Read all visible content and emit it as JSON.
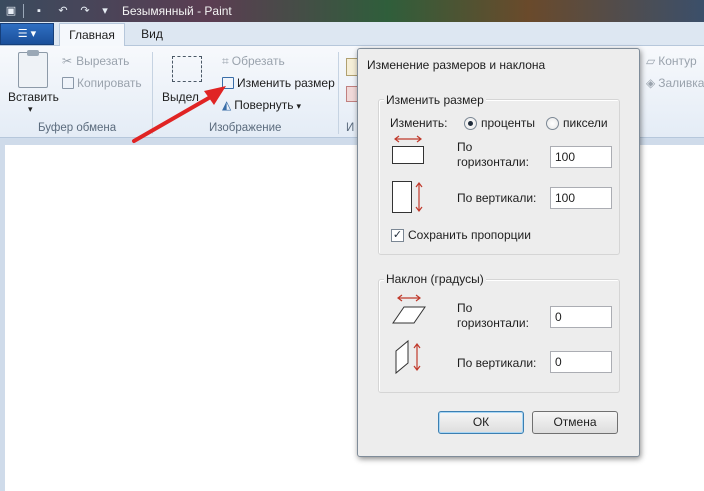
{
  "app": {
    "window_title": "Безымянный - Paint"
  },
  "tabs": {
    "file_icon": "menu-icon",
    "home": "Главная",
    "view": "Вид"
  },
  "ribbon": {
    "clipboard": {
      "paste": "Вставить",
      "cut": "Вырезать",
      "copy": "Копировать",
      "label": "Буфер обмена"
    },
    "image": {
      "select": "Выдел",
      "crop": "Обрезать",
      "resize": "Изменить размер",
      "rotate": "Повернуть",
      "label": "Изображение"
    },
    "tools_label": "И",
    "shapes": {
      "outline": "Контур",
      "fill": "Заливка"
    }
  },
  "dialog": {
    "title": "Изменение размеров и наклона",
    "resize": {
      "legend": "Изменить размер",
      "by_label": "Изменить:",
      "percent": "проценты",
      "pixels": "пиксели",
      "selected": "percent",
      "horizontal_label_1": "По",
      "horizontal_label_2": "горизонтали:",
      "horizontal_value": "100",
      "vertical_label": "По вертикали:",
      "vertical_value": "100",
      "keep_ratio": "Сохранить пропорции",
      "keep_ratio_checked": true
    },
    "skew": {
      "legend": "Наклон (градусы)",
      "horizontal_label_1": "По",
      "horizontal_label_2": "горизонтали:",
      "horizontal_value": "0",
      "vertical_label": "По вертикали:",
      "vertical_value": "0"
    },
    "ok": "ОК",
    "cancel": "Отмена"
  },
  "colors": {
    "arrow": "#e02424",
    "icon_arrow": "#c0392b"
  }
}
